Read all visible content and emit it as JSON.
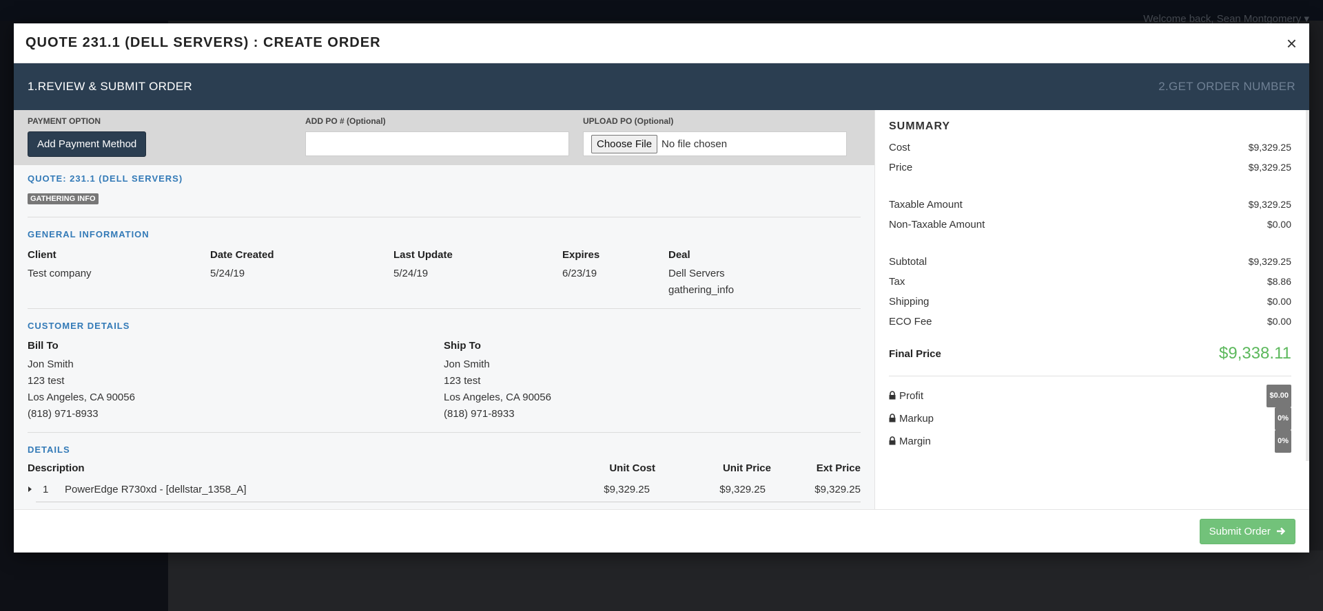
{
  "background": {
    "welcome": "Welcome back, Sean Montgomery ▾"
  },
  "modal": {
    "title": "QUOTE 231.1 (DELL SERVERS) : CREATE ORDER",
    "close_icon": "×",
    "steps": {
      "active": "1.REVIEW & SUBMIT ORDER",
      "inactive": "2.GET ORDER NUMBER"
    },
    "payment": {
      "label": "PAYMENT OPTION",
      "button": "Add Payment Method"
    },
    "po": {
      "label": "ADD PO # (Optional)",
      "value": ""
    },
    "upload": {
      "label": "UPLOAD PO (Optional)",
      "button": "Choose File",
      "status": "No file chosen"
    },
    "quote": {
      "title": "QUOTE: 231.1 (DELL SERVERS)",
      "status_badge": "GATHERING INFO"
    },
    "general": {
      "title": "GENERAL INFORMATION",
      "client_label": "Client",
      "client_value": "Test company",
      "date_created_label": "Date Created",
      "date_created_value": "5/24/19",
      "last_update_label": "Last Update",
      "last_update_value": "5/24/19",
      "expires_label": "Expires",
      "expires_value": "6/23/19",
      "deal_label": "Deal",
      "deal_value_1": "Dell Servers",
      "deal_value_2": "gathering_info"
    },
    "customer": {
      "title": "CUSTOMER DETAILS",
      "bill_to": {
        "label": "Bill To",
        "name": "Jon Smith",
        "street": "123 test",
        "city": "Los Angeles, CA 90056",
        "phone": "(818) 971-8933"
      },
      "ship_to": {
        "label": "Ship To",
        "name": "Jon Smith",
        "street": "123 test",
        "city": "Los Angeles, CA 90056",
        "phone": "(818) 971-8933"
      }
    },
    "details": {
      "title": "DETAILS",
      "headers": {
        "description": "Description",
        "unit_cost": "Unit Cost",
        "unit_price": "Unit Price",
        "ext_price": "Ext Price"
      },
      "rows": [
        {
          "qty": "1",
          "description": "PowerEdge R730xd - [dellstar_1358_A]",
          "unit_cost": "$9,329.25",
          "unit_price": "$9,329.25",
          "ext_price": "$9,329.25"
        }
      ]
    },
    "summary": {
      "title": "SUMMARY",
      "cost_label": "Cost",
      "cost_value": "$9,329.25",
      "price_label": "Price",
      "price_value": "$9,329.25",
      "taxable_label": "Taxable Amount",
      "taxable_value": "$9,329.25",
      "nontaxable_label": "Non-Taxable Amount",
      "nontaxable_value": "$0.00",
      "subtotal_label": "Subtotal",
      "subtotal_value": "$9,329.25",
      "tax_label": "Tax",
      "tax_value": "$8.86",
      "shipping_label": "Shipping",
      "shipping_value": "$0.00",
      "eco_label": "ECO Fee",
      "eco_value": "$0.00",
      "final_label": "Final Price",
      "final_value": "$9,338.11",
      "profit_label": "Profit",
      "profit_value": "$0.00",
      "markup_label": "Markup",
      "markup_value": "0%",
      "margin_label": "Margin",
      "margin_value": "0%"
    },
    "footer": {
      "submit_label": "Submit Order"
    }
  },
  "colors": {
    "steps_bar": "#2b3e51",
    "accent_blue": "#337ab7",
    "final_price_green": "#5cb85c",
    "submit_green": "#72c27a"
  }
}
